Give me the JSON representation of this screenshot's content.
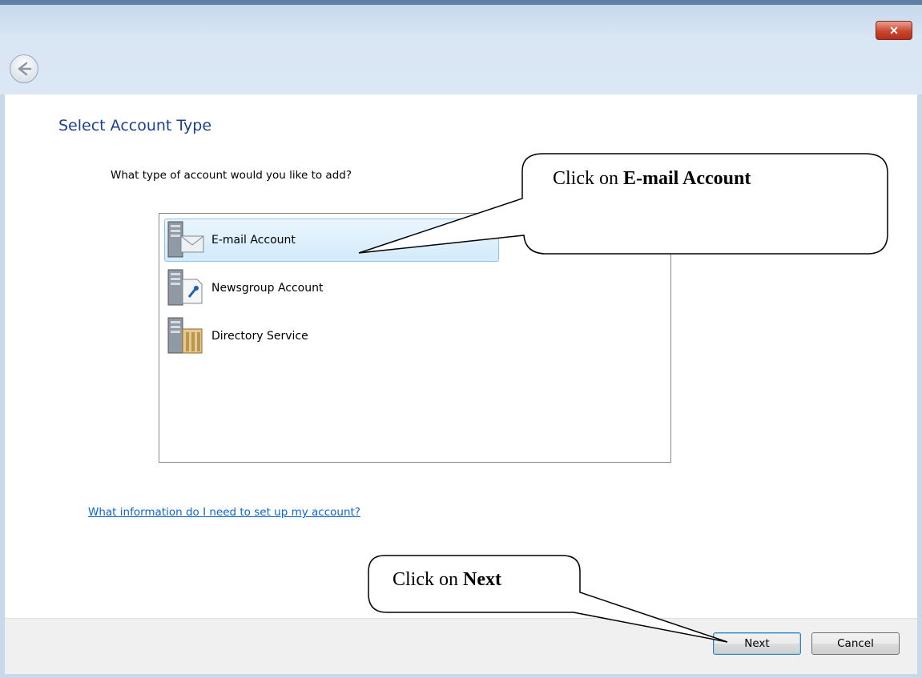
{
  "window": {
    "close_glyph": "✕"
  },
  "dialog": {
    "title": "Select Account Type",
    "question": "What type of account would you like to add?",
    "account_types": [
      {
        "label": "E-mail Account",
        "icon": "email-server-icon",
        "selected": true
      },
      {
        "label": "Newsgroup Account",
        "icon": "newsgroup-server-icon",
        "selected": false
      },
      {
        "label": "Directory Service",
        "icon": "directory-server-icon",
        "selected": false
      }
    ],
    "help_link": "What information do I need to set up my account?"
  },
  "buttons": {
    "next": "Next",
    "cancel": "Cancel"
  },
  "annotations": {
    "email_callout_prefix": "Click on ",
    "email_callout_bold": "E-mail Account",
    "next_callout_prefix": "Click on ",
    "next_callout_bold": "Next"
  },
  "colors": {
    "title_blue": "#1e3f8f",
    "link_blue": "#0b66d0",
    "selection_bg": "#d3ebfb",
    "close_red": "#c9462f"
  }
}
